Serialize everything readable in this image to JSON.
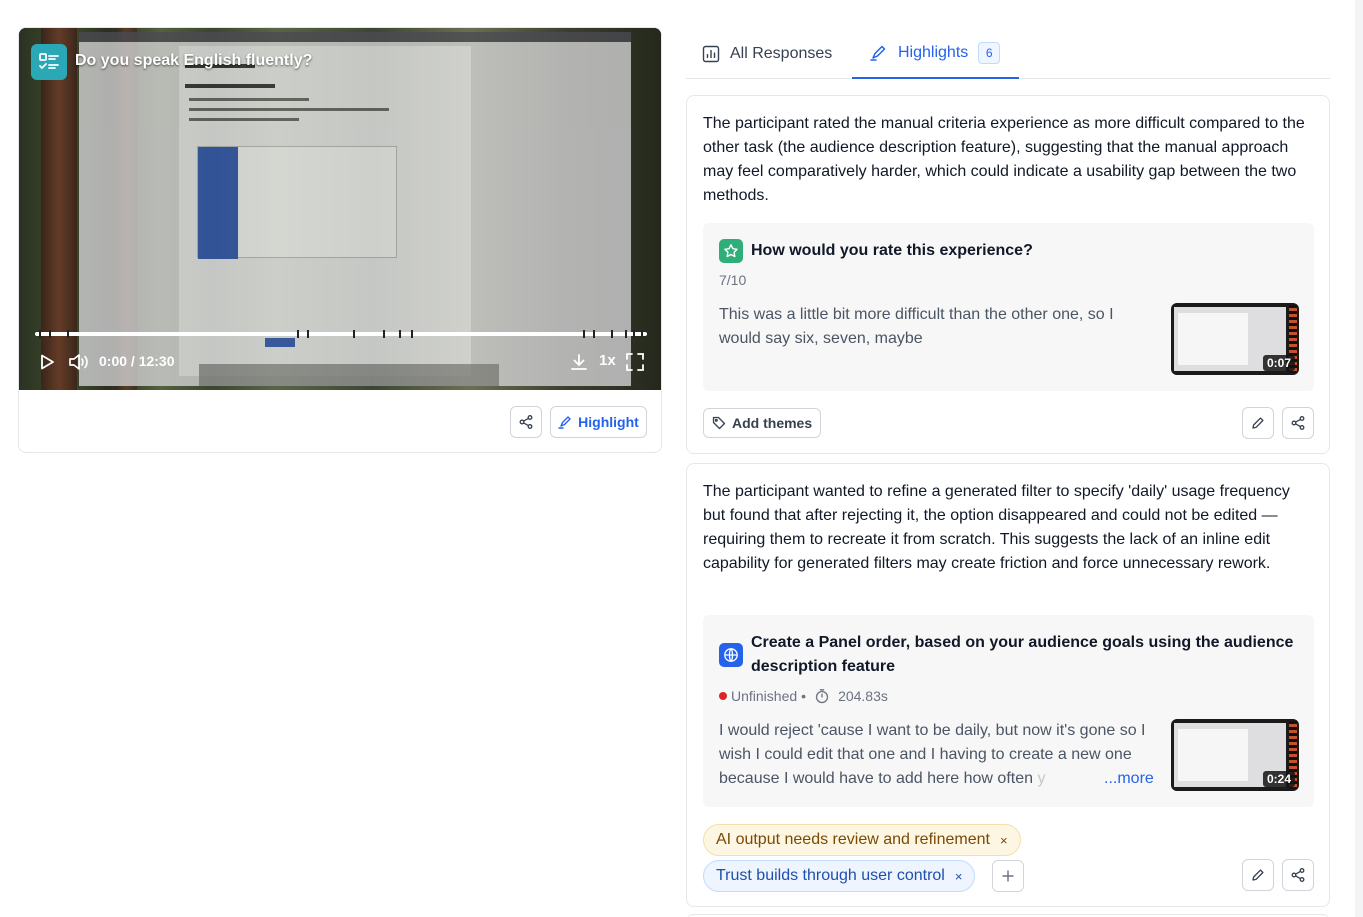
{
  "video": {
    "title": "Do you speak English fluently?",
    "time": "0:00 / 12:30",
    "speed": "1x",
    "highlight_label": "Highlight"
  },
  "tabs": [
    {
      "label": "All Responses"
    },
    {
      "label": "Highlights",
      "count": "6"
    }
  ],
  "highlights": [
    {
      "summary": "The participant rated the manual criteria experience as more difficult compared to the other task (the audience description feature), suggesting that the manual approach may feel comparatively harder, which could indicate a usability gap between the two methods.",
      "question": "How would you rate this experience?",
      "question_icon": "star-icon",
      "question_color": "#2fae7a",
      "meta": "7/10",
      "quote": "This was a little bit more difficult than the other one, so I would say six, seven, maybe",
      "thumb_duration": "0:07",
      "add_themes_label": "Add themes"
    },
    {
      "summary": "The participant wanted to refine a generated filter to specify 'daily' usage frequency but found that after rejecting it, the option disappeared and could not be edited — requiring them to recreate it from scratch. This suggests the lack of an inline edit capability for generated filters may create friction and force unnecessary rework.",
      "question": "Create a Panel order, based on your audience goals using the audience description feature",
      "question_icon": "globe-icon",
      "question_color": "#2563eb",
      "status": "Unfinished",
      "status_sep": "•",
      "duration": "204.83s",
      "quote_main": "I would reject 'cause I want to be daily, but now it's gone so I wish I could edit that one and I having to create a new one because I would have to add here how often ",
      "quote_fade": "y",
      "more_label": "...more",
      "thumb_duration": "0:24",
      "themes": [
        {
          "label": "AI output needs review and refinement",
          "color": "#fdf6e3"
        },
        {
          "label": "Trust builds through user control",
          "color": "#eef5fe"
        }
      ],
      "remove_glyph": "×"
    }
  ]
}
